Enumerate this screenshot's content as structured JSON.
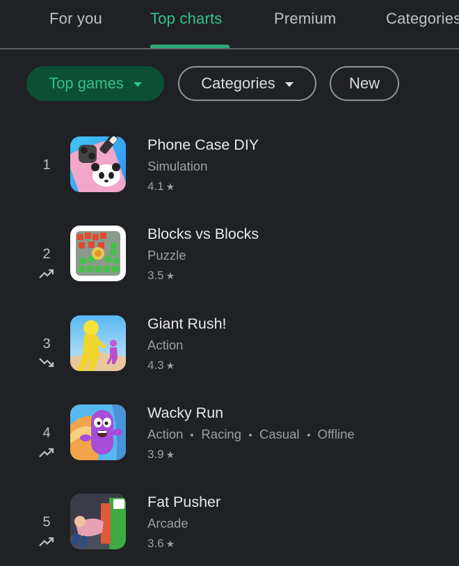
{
  "tabs": [
    {
      "label": "For you"
    },
    {
      "label": "Top charts",
      "active": true
    },
    {
      "label": "Premium"
    },
    {
      "label": "Categories"
    }
  ],
  "chips": {
    "top_games": "Top games",
    "categories": "Categories",
    "new": "New"
  },
  "apps": [
    {
      "rank": "1",
      "trend": "none",
      "title": "Phone Case DIY",
      "categories": [
        "Simulation"
      ],
      "rating": "4.1",
      "icon": "phone-case-diy-app-icon"
    },
    {
      "rank": "2",
      "trend": "up",
      "title": "Blocks vs Blocks",
      "categories": [
        "Puzzle"
      ],
      "rating": "3.5",
      "icon": "blocks-vs-blocks-app-icon"
    },
    {
      "rank": "3",
      "trend": "down",
      "title": "Giant Rush!",
      "categories": [
        "Action"
      ],
      "rating": "4.3",
      "icon": "giant-rush-app-icon"
    },
    {
      "rank": "4",
      "trend": "up",
      "title": "Wacky Run",
      "categories": [
        "Action",
        "Racing",
        "Casual",
        "Offline"
      ],
      "rating": "3.9",
      "icon": "wacky-run-app-icon"
    },
    {
      "rank": "5",
      "trend": "up",
      "title": "Fat Pusher",
      "categories": [
        "Arcade"
      ],
      "rating": "3.6",
      "icon": "fat-pusher-app-icon"
    }
  ],
  "colors": {
    "background": "#202124",
    "accent": "#35c18a",
    "chip_selected_bg": "#0b4f34"
  }
}
